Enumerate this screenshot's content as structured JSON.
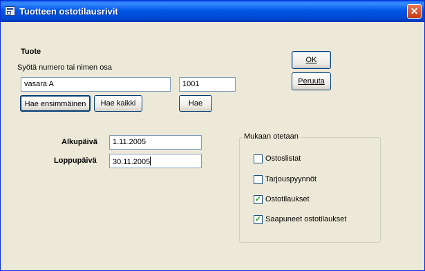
{
  "window": {
    "title": "Tuotteen ostotilausrivit",
    "close_glyph": "✕",
    "accent": "#0058e6"
  },
  "product": {
    "heading": "Tuote",
    "hint": "Syötä numero tai nimen osa",
    "name_value": "vasara A",
    "number_value": "1001",
    "find_first_label": "Hae ensimmäinen",
    "find_all_label": "Hae kaikki",
    "find_label": "Hae"
  },
  "dates": {
    "start_label": "Alkupäivä",
    "start_value": "1.11.2005",
    "end_label": "Loppupäivä",
    "end_value": "30.11.2005"
  },
  "actions": {
    "ok_label": "OK",
    "cancel_label": "Peruuta"
  },
  "include": {
    "legend": "Mukaan otetaan",
    "items": [
      {
        "label": "Ostoslistat",
        "checked": false
      },
      {
        "label": "Tarjouspyynnöt",
        "checked": false
      },
      {
        "label": "Ostotilaukset",
        "checked": true
      },
      {
        "label": "Saapuneet ostotilaukset",
        "checked": true
      }
    ]
  }
}
